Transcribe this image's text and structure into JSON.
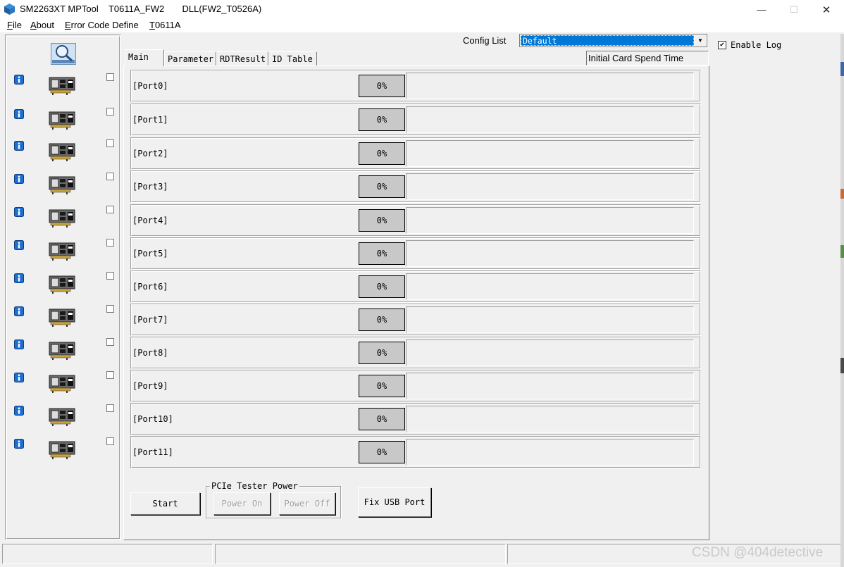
{
  "window": {
    "title": "SM2263XT MPTool    T0611A_FW2       DLL(FW2_T0526A)",
    "controls": {
      "minimize": "—",
      "maximize": "☐",
      "close": "✕"
    }
  },
  "menu": {
    "items": [
      {
        "key": "F",
        "rest": "ile"
      },
      {
        "key": "A",
        "rest": "bout"
      },
      {
        "key": "E",
        "rest": "rror Code Define"
      },
      {
        "key": "T",
        "rest": "0611A"
      }
    ]
  },
  "config": {
    "label": "Config List",
    "selected": "Default",
    "enable_log_label": "Enable Log",
    "enable_log_checked": true
  },
  "tabs": [
    {
      "label": "Main",
      "active": true
    },
    {
      "label": "Parameter",
      "active": false
    },
    {
      "label": "RDTResult",
      "active": false
    },
    {
      "label": "ID Table",
      "active": false
    }
  ],
  "initial_card_spend_time": "Initial Card Spend Time",
  "ports": [
    {
      "label": "[Port0]",
      "percent": "0%",
      "progress": 0
    },
    {
      "label": "[Port1]",
      "percent": "0%",
      "progress": 0
    },
    {
      "label": "[Port2]",
      "percent": "0%",
      "progress": 0
    },
    {
      "label": "[Port3]",
      "percent": "0%",
      "progress": 0
    },
    {
      "label": "[Port4]",
      "percent": "0%",
      "progress": 0
    },
    {
      "label": "[Port5]",
      "percent": "0%",
      "progress": 0
    },
    {
      "label": "[Port6]",
      "percent": "0%",
      "progress": 0
    },
    {
      "label": "[Port7]",
      "percent": "0%",
      "progress": 0
    },
    {
      "label": "[Port8]",
      "percent": "0%",
      "progress": 0
    },
    {
      "label": "[Port9]",
      "percent": "0%",
      "progress": 0
    },
    {
      "label": "[Port10]",
      "percent": "0%",
      "progress": 0
    },
    {
      "label": "[Port11]",
      "percent": "0%",
      "progress": 0
    }
  ],
  "slots": {
    "count": 12,
    "info_icon": "info-icon",
    "card_icon": "pcie-card-icon",
    "checked": [
      false,
      false,
      false,
      false,
      false,
      false,
      false,
      false,
      false,
      false,
      false,
      false
    ]
  },
  "buttons": {
    "start": "Start",
    "pcie_group_title": "PCIe Tester Power",
    "power_on": "Power On",
    "power_off": "Power Off",
    "fix_usb_port": "Fix USB Port"
  },
  "watermark": "CSDN @404detective",
  "colors": {
    "window_bg": "#f0f0f0",
    "selection": "#0078d7",
    "percent_box": "#c8c8c8",
    "progress_fill": "#06b025"
  }
}
